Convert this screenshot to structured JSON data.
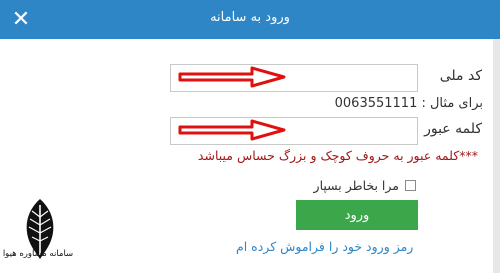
{
  "dialog": {
    "title": "ورود به سامانه"
  },
  "form": {
    "national_code_label": "کد ملی",
    "national_code_value": "",
    "example_text": "برای مثال : 0063551111",
    "password_label": "کلمه عبور",
    "password_value": "",
    "case_warning": "***کلمه عبور به حروف کوچک و بزرگ حساس میباشد",
    "remember_label": "مرا بخاطر بسپار",
    "remember_checked": false,
    "login_label": "ورود",
    "forgot_label": "رمز ورود خود را فراموش کرده ام"
  },
  "logo": {
    "text": "سامانه مشاوره هیوا"
  },
  "colors": {
    "header": "#2f86c7",
    "login_button": "#3ba64a",
    "warning": "#a01818",
    "arrow": "#e01010"
  },
  "icons": {
    "close": "close-icon",
    "arrow": "red-arrow-icon"
  }
}
